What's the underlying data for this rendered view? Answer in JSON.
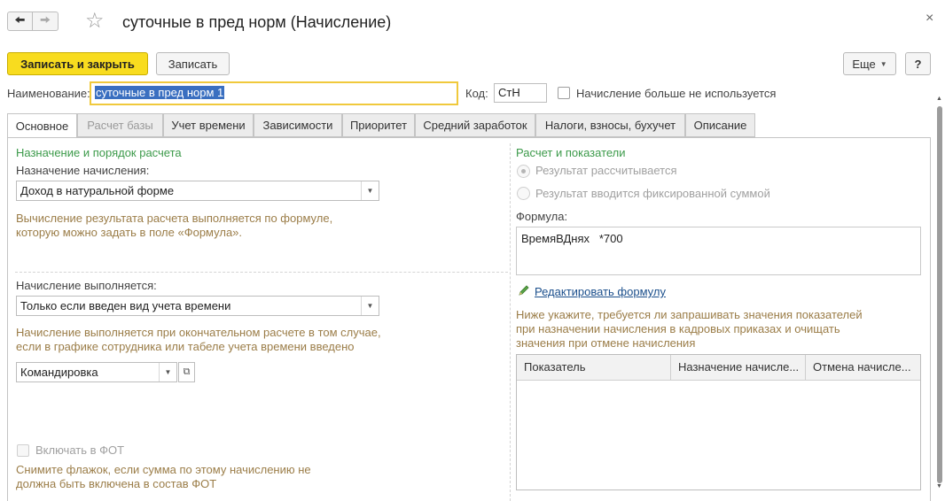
{
  "window": {
    "title": "суточные в пред норм (Начисление)",
    "back_icon": "arrow-left-icon",
    "forward_icon": "arrow-right-icon",
    "favorite_icon": "star-icon",
    "close_symbol": "×"
  },
  "toolbar": {
    "save_close": "Записать и закрыть",
    "save": "Записать",
    "more": "Еще",
    "help": "?"
  },
  "header_fields": {
    "name_label": "Наименование:",
    "name_value": "суточные в пред норм 1",
    "code_label": "Код:",
    "code_value": "СтН",
    "unused_label": "Начисление больше не используется",
    "unused_checked": false
  },
  "tabs": [
    {
      "label": "Основное",
      "active": true,
      "enabled": true
    },
    {
      "label": "Расчет базы",
      "active": false,
      "enabled": false
    },
    {
      "label": "Учет времени",
      "active": false,
      "enabled": true
    },
    {
      "label": "Зависимости",
      "active": false,
      "enabled": true
    },
    {
      "label": "Приоритет",
      "active": false,
      "enabled": true
    },
    {
      "label": "Средний заработок",
      "active": false,
      "enabled": true
    },
    {
      "label": "Налоги, взносы, бухучет",
      "active": false,
      "enabled": true
    },
    {
      "label": "Описание",
      "active": false,
      "enabled": true
    }
  ],
  "left": {
    "section_title": "Назначение и порядок расчета",
    "purpose_label": "Назначение начисления:",
    "purpose_value": "Доход в натуральной форме",
    "purpose_hint_1": "Вычисление результата расчета выполняется по формуле,",
    "purpose_hint_2": "которую можно задать в поле «Формула».",
    "exec_label": "Начисление выполняется:",
    "exec_value": "Только если введен вид учета времени",
    "exec_hint_1": "Начисление выполняется при окончательном расчете в том случае,",
    "exec_hint_2": "если в графике сотрудника или табеле учета времени введено",
    "time_type_value": "Командировка",
    "fot_label": "Включать в ФОТ",
    "fot_hint_1": "Снимите флажок, если сумма по этому начислению не",
    "fot_hint_2": "должна быть включена в состав ФОТ"
  },
  "right": {
    "section_title": "Расчет и показатели",
    "radio_calculated": "Результат рассчитывается",
    "radio_fixed": "Результат вводится фиксированной суммой",
    "formula_label": "Формула:",
    "formula_value": "ВремяВДнях   *700",
    "edit_formula_link": "Редактировать формулу",
    "indicators_hint_1": "Ниже укажите, требуется ли запрашивать значения показателей",
    "indicators_hint_2": "при назначении начисления в кадровых приказах и очищать",
    "indicators_hint_3": "значения при отмене начисления",
    "table_columns": [
      "Показатель",
      "Назначение начисле...",
      "Отмена начисле..."
    ]
  },
  "colors": {
    "primary_button": "#f8dc1f",
    "section_title": "#3c9a4a",
    "hint_text": "#9b7d48",
    "link": "#1b4f8c",
    "focus_border": "#f0c93c"
  }
}
